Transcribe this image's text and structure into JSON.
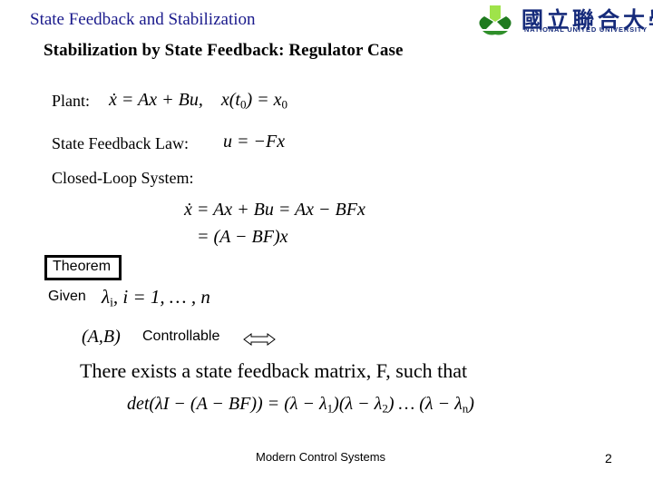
{
  "header": {
    "title": "State Feedback and Stabilization",
    "subtitle": "Stabilization by State Feedback: Regulator Case"
  },
  "logo": {
    "icon": "knot-logo-icon",
    "chinese_name": "國立聯合大學",
    "english_name": "NATIONAL UNITED UNIVERSITY",
    "colors": {
      "light_green": "#9fe34a",
      "dark_green": "#1f7a1f",
      "text_blue": "#152a7a"
    }
  },
  "colors": {
    "header_title": "#1a1a8c",
    "body_text": "#000000"
  },
  "content": {
    "plant": {
      "label": "Plant:",
      "eq_lhs": "ẋ",
      "eq_part1": " = Ax + Bu,",
      "eq_part2": "x(t",
      "eq_sub0": "0",
      "eq_part3": ") = x",
      "eq_sub1": "0"
    },
    "state_feedback": {
      "label": "State Feedback Law:",
      "equation": "u = −Fx"
    },
    "closed_loop": {
      "label": "Closed-Loop System:",
      "line1": "ẋ = Ax + Bu = Ax − BFx",
      "line2": "= (A − BF)x"
    },
    "theorem": {
      "label": "Theorem",
      "given": "Given",
      "given_lambda": "λ",
      "given_lambda_sub": "i",
      "given_rest": ",   i = 1, … , n",
      "pair": "(A,B)",
      "controllable": "Controllable",
      "iff_icon": "double-arrow-icon",
      "exists": "There exists a state feedback matrix, F, such that",
      "det_lhs": "det(λI − (A − BF)) = ",
      "det_f1": "(λ − λ",
      "det_s1": "1",
      "det_f2": ")(λ − λ",
      "det_s2": "2",
      "det_dots": ") … ",
      "det_f3": "(λ − λ",
      "det_sn": "n",
      "det_close": ")"
    }
  },
  "footer": {
    "course": "Modern Control Systems",
    "page": "2"
  }
}
